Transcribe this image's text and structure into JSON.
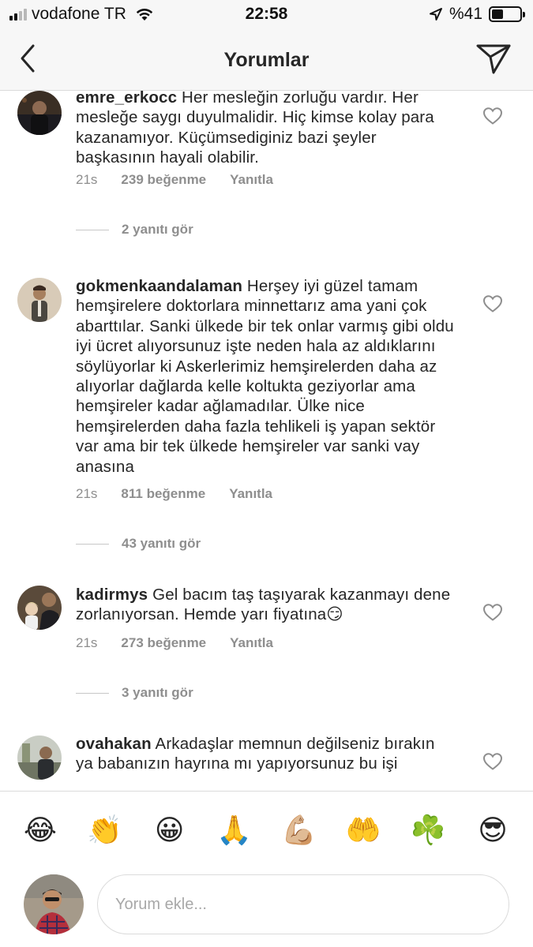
{
  "status_bar": {
    "carrier": "vodafone TR",
    "time": "22:58",
    "battery_percent_label": "%41",
    "battery_level": 0.41,
    "icons": [
      "signal-icon",
      "wifi-icon",
      "location-arrow-icon",
      "battery-icon"
    ]
  },
  "header": {
    "title": "Yorumlar",
    "back_icon": "chevron-left-icon",
    "send_icon": "paper-plane-icon"
  },
  "comments": [
    {
      "username": "emre_erkocc",
      "text": "Her mesleğin zorluğu vardır. Her mesleğe saygı duyulmalidir. Hiç kimse kolay para kazanamıyor. Küçümsediginiz bazi şeyler başkasının hayali olabilir.",
      "time": "21s",
      "likes": "239 beğenme",
      "reply": "Yanıtla",
      "view_replies": "2 yanıtı gör"
    },
    {
      "username": "gokmenkaandalaman",
      "text": "Herşey iyi güzel tamam hemşirelere doktorlara minnettarız ama yani çok abarttılar. Sanki ülkede bir tek onlar varmış gibi oldu iyi ücret alıyorsunuz işte neden hala az aldıklarını söylüyorlar ki Askerlerimiz hemşirelerden daha az alıyorlar dağlarda kelle koltukta geziyorlar ama hemşireler kadar ağlamadılar. Ülke nice hemşirelerden daha fazla tehlikeli iş yapan sektör var ama bir tek ülkede hemşireler var sanki vay anasına",
      "time": "21s",
      "likes": "811 beğenme",
      "reply": "Yanıtla",
      "view_replies": "43 yanıtı gör"
    },
    {
      "username": "kadirmys",
      "text": "Gel bacım taş taşıyarak kazanmayı dene zorlanıyorsan. Hemde yarı fiyatına😏",
      "time": "21s",
      "likes": "273 beğenme",
      "reply": "Yanıtla",
      "view_replies": "3 yanıtı gör"
    },
    {
      "username": "ovahakan",
      "text": "Arkadaşlar memnun değilseniz bırakın ya babanızın hayrına mı yapıyorsunuz bu işi"
    }
  ],
  "emoji_bar": [
    "😂",
    "👏",
    "😀",
    "🙏",
    "💪🏼",
    "🤲",
    "☘️",
    "😎"
  ],
  "composer": {
    "placeholder": "Yorum ekle..."
  }
}
